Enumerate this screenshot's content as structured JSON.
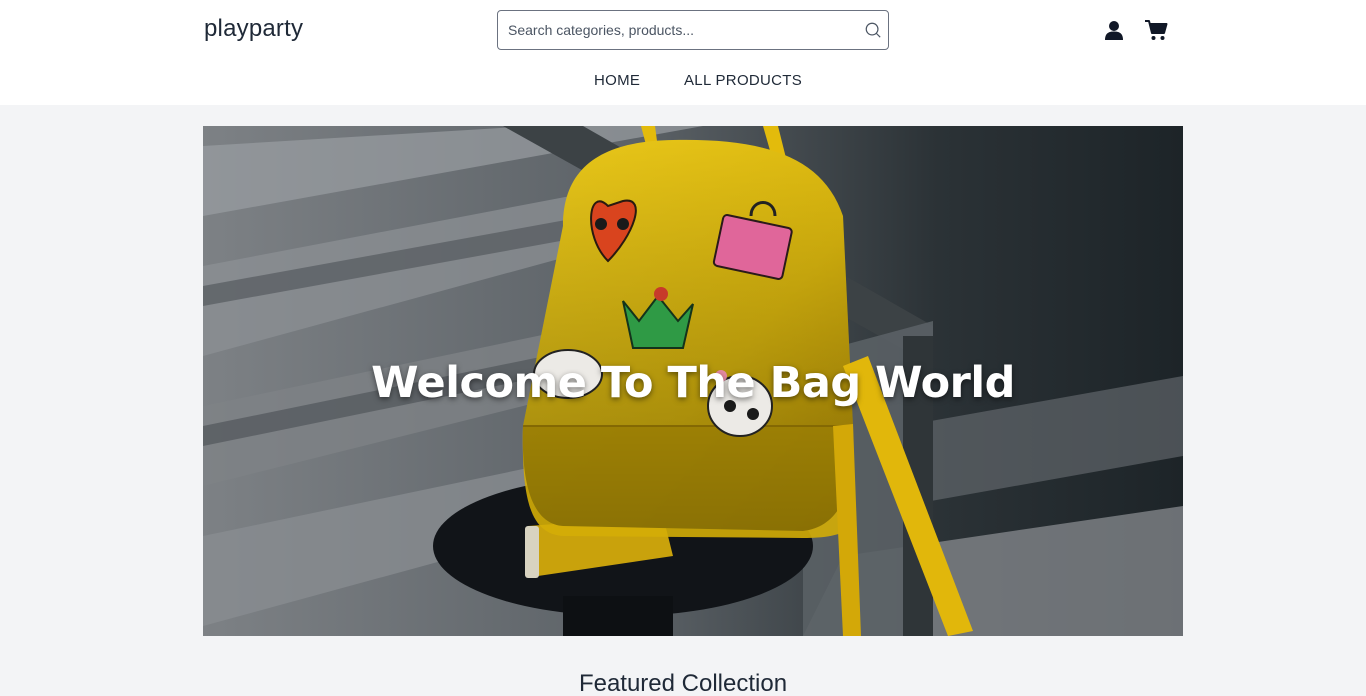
{
  "header": {
    "logo": "playparty",
    "search": {
      "placeholder": "Search categories, products..."
    },
    "icons": [
      "search-icon",
      "user-icon",
      "cart-icon"
    ]
  },
  "nav": {
    "items": [
      {
        "label": "HOME"
      },
      {
        "label": "ALL PRODUCTS"
      }
    ]
  },
  "hero": {
    "title": "Welcome To The Bag World",
    "image": "yellow-backpack-photo"
  },
  "featured": {
    "title": "Featured Collection"
  }
}
